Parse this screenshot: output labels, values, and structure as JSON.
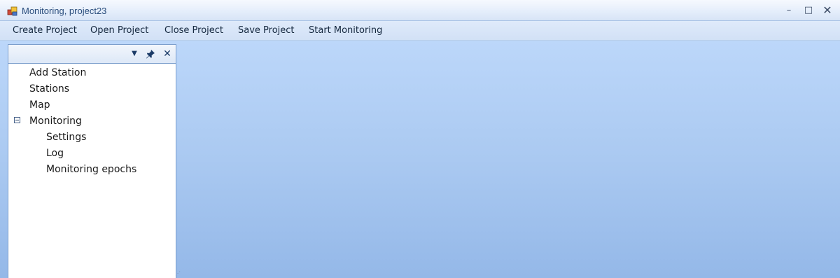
{
  "window": {
    "title": "Monitoring, project23",
    "controls": {
      "minimize": "–",
      "maximize": "□",
      "close": "✕"
    }
  },
  "menu": {
    "items": [
      "Create Project",
      "Open Project",
      "Close Project",
      "Save Project",
      "Start Monitoring"
    ]
  },
  "panel": {
    "header_buttons": {
      "dropdown": "▼",
      "pin": "✎",
      "close": "✕"
    },
    "tree": {
      "items": [
        {
          "label": "Add Station"
        },
        {
          "label": "Stations"
        },
        {
          "label": "Map"
        },
        {
          "label": "Monitoring",
          "expanded": true
        },
        {
          "label": "Settings"
        },
        {
          "label": "Log"
        },
        {
          "label": "Monitoring epochs"
        }
      ]
    }
  },
  "colors": {
    "workspace_top": "#bcd7fa",
    "workspace_bottom": "#94b8e8",
    "title_text": "#2a4d7c",
    "panel_border": "#7a9dcc"
  },
  "icons": {
    "app": "app-icon",
    "expander": "collapse-icon",
    "dropdown": "chevron-down-icon",
    "pin": "pin-icon",
    "close": "close-icon"
  }
}
